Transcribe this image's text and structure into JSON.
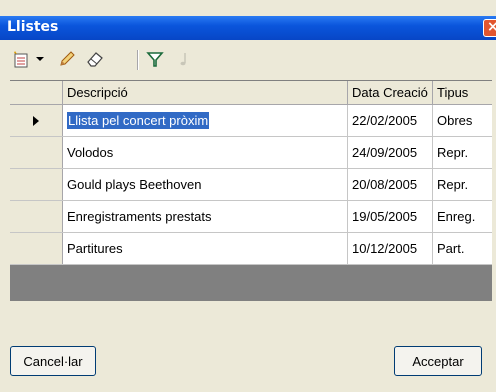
{
  "window": {
    "title": "Llistes"
  },
  "toolbar": {
    "icons": [
      "new-list-icon",
      "dropdown-arrow-icon",
      "edit-pencil-icon",
      "eraser-icon",
      "filter-icon",
      "music-note-icon"
    ]
  },
  "table": {
    "columns": [
      "Descripció",
      "Data Creació",
      "Tipus"
    ],
    "rows": [
      {
        "description": "Llista pel concert pròxim",
        "date": "22/02/2005",
        "type": "Obres",
        "selected": true
      },
      {
        "description": "Volodos",
        "date": "24/09/2005",
        "type": "Repr."
      },
      {
        "description": "Gould plays Beethoven",
        "date": "20/08/2005",
        "type": "Repr."
      },
      {
        "description": "Enregistraments prestats",
        "date": "19/05/2005",
        "type": "Enreg."
      },
      {
        "description": "Partitures",
        "date": "10/12/2005",
        "type": "Part."
      }
    ]
  },
  "buttons": {
    "cancel": "Cancel·lar",
    "accept": "Acceptar"
  },
  "colors": {
    "titlebar": "#0a55dc",
    "selection": "#316ac5",
    "grid_empty": "#808080",
    "dialog_bg": "#ece9d8"
  }
}
